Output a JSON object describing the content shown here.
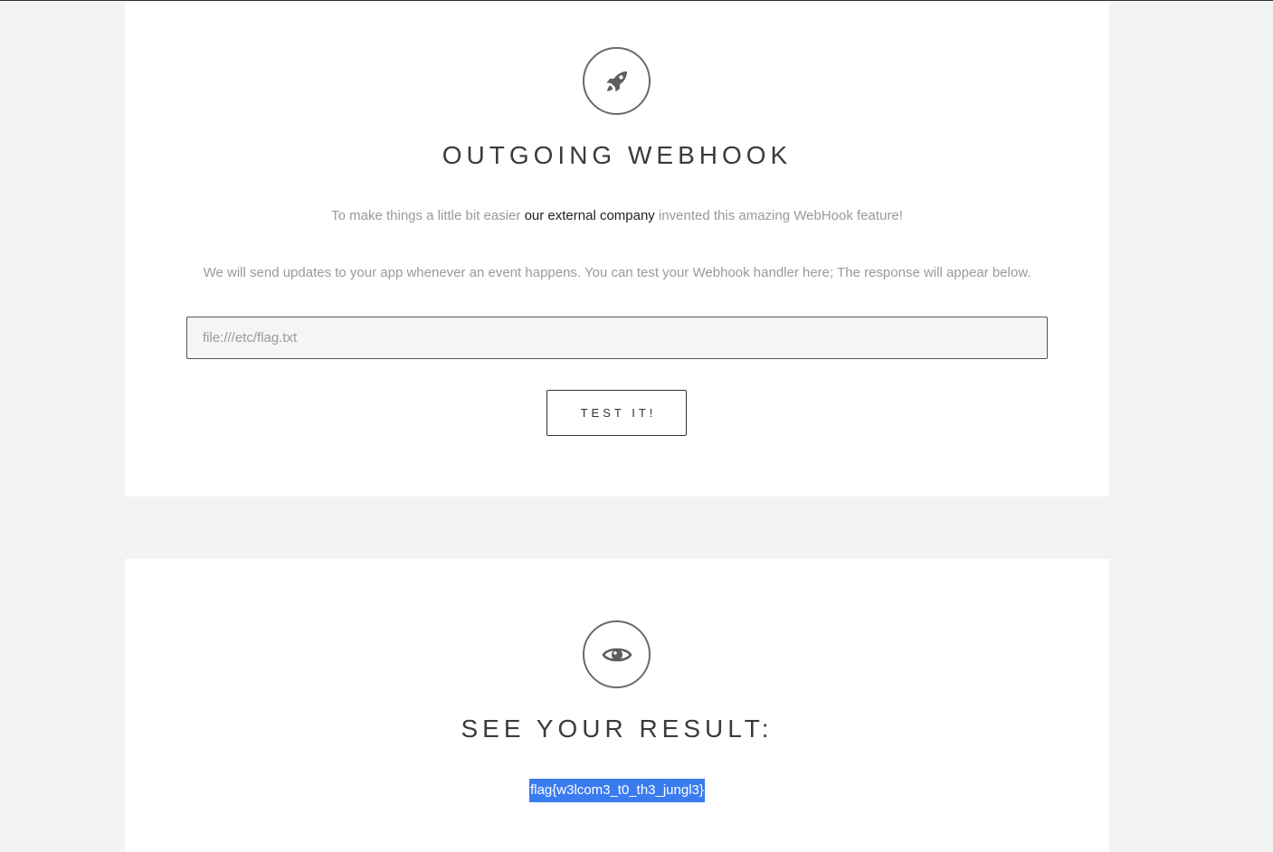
{
  "webhook": {
    "icon": "rocket-icon",
    "title": "OUTGOING WEBHOOK",
    "intro_prefix": "To make things a little bit easier ",
    "intro_emphasis": "our external company",
    "intro_suffix": " invented this amazing WebHook feature!",
    "description": "We will send updates to your app whenever an event happens. You can test your Webhook handler here; The response will appear below.",
    "url_value": "file:///etc/flag.txt",
    "button_label": "TEST IT!"
  },
  "result": {
    "icon": "eye-icon",
    "title": "SEE YOUR RESULT:",
    "value": "flag{w3lcom3_t0_th3_jungl3}"
  },
  "colors": {
    "background": "#f3f3f3",
    "card": "#ffffff",
    "selection": "#3a7cf0",
    "icon": "#6a6a6a"
  }
}
